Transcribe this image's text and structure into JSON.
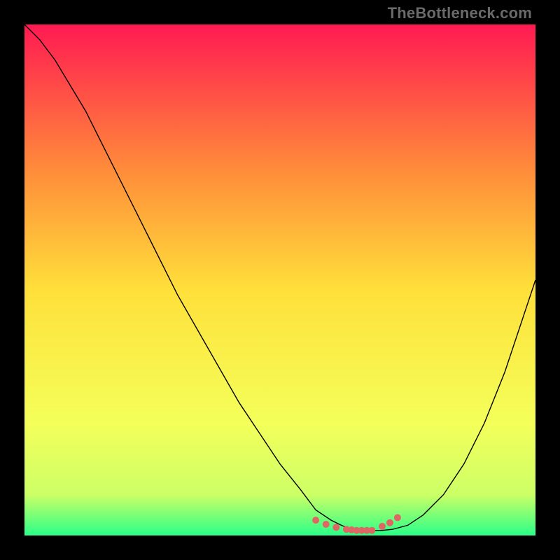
{
  "watermark": "TheBottleneck.com",
  "chart_data": {
    "type": "line",
    "title": "",
    "xlabel": "",
    "ylabel": "",
    "xlim": [
      0,
      100
    ],
    "ylim": [
      0,
      100
    ],
    "grid": false,
    "legend": false,
    "background_gradient": {
      "top": "#ff1a52",
      "mid_upper": "#ff8a3a",
      "mid": "#ffe03a",
      "mid_lower": "#f4ff5a",
      "near_bottom": "#ccff66",
      "bottom": "#2aff88"
    },
    "series": [
      {
        "name": "curve",
        "color": "#000000",
        "stroke_width": 1.4,
        "x": [
          0,
          3,
          6,
          9,
          12,
          15,
          18,
          22,
          26,
          30,
          34,
          38,
          42,
          46,
          50,
          54,
          57,
          60,
          62,
          64,
          66,
          68,
          70,
          72,
          75,
          78,
          82,
          86,
          90,
          94,
          98,
          100
        ],
        "y": [
          100,
          97,
          93,
          88,
          83,
          77,
          71,
          63,
          55,
          47,
          40,
          33,
          26,
          20,
          14,
          9,
          5,
          3,
          2,
          1.2,
          1.0,
          1.0,
          1.0,
          1.2,
          2,
          4,
          8,
          14,
          22,
          32,
          44,
          50
        ]
      },
      {
        "name": "bottom-highlight-dots",
        "color": "#e06666",
        "type": "scatter",
        "marker_size": 10,
        "x": [
          57,
          59,
          61,
          63,
          64,
          65,
          66,
          67,
          68,
          70,
          71.5,
          73
        ],
        "y": [
          3.0,
          2.2,
          1.6,
          1.2,
          1.1,
          1.0,
          1.0,
          1.0,
          1.0,
          1.8,
          2.5,
          3.5
        ]
      }
    ]
  }
}
